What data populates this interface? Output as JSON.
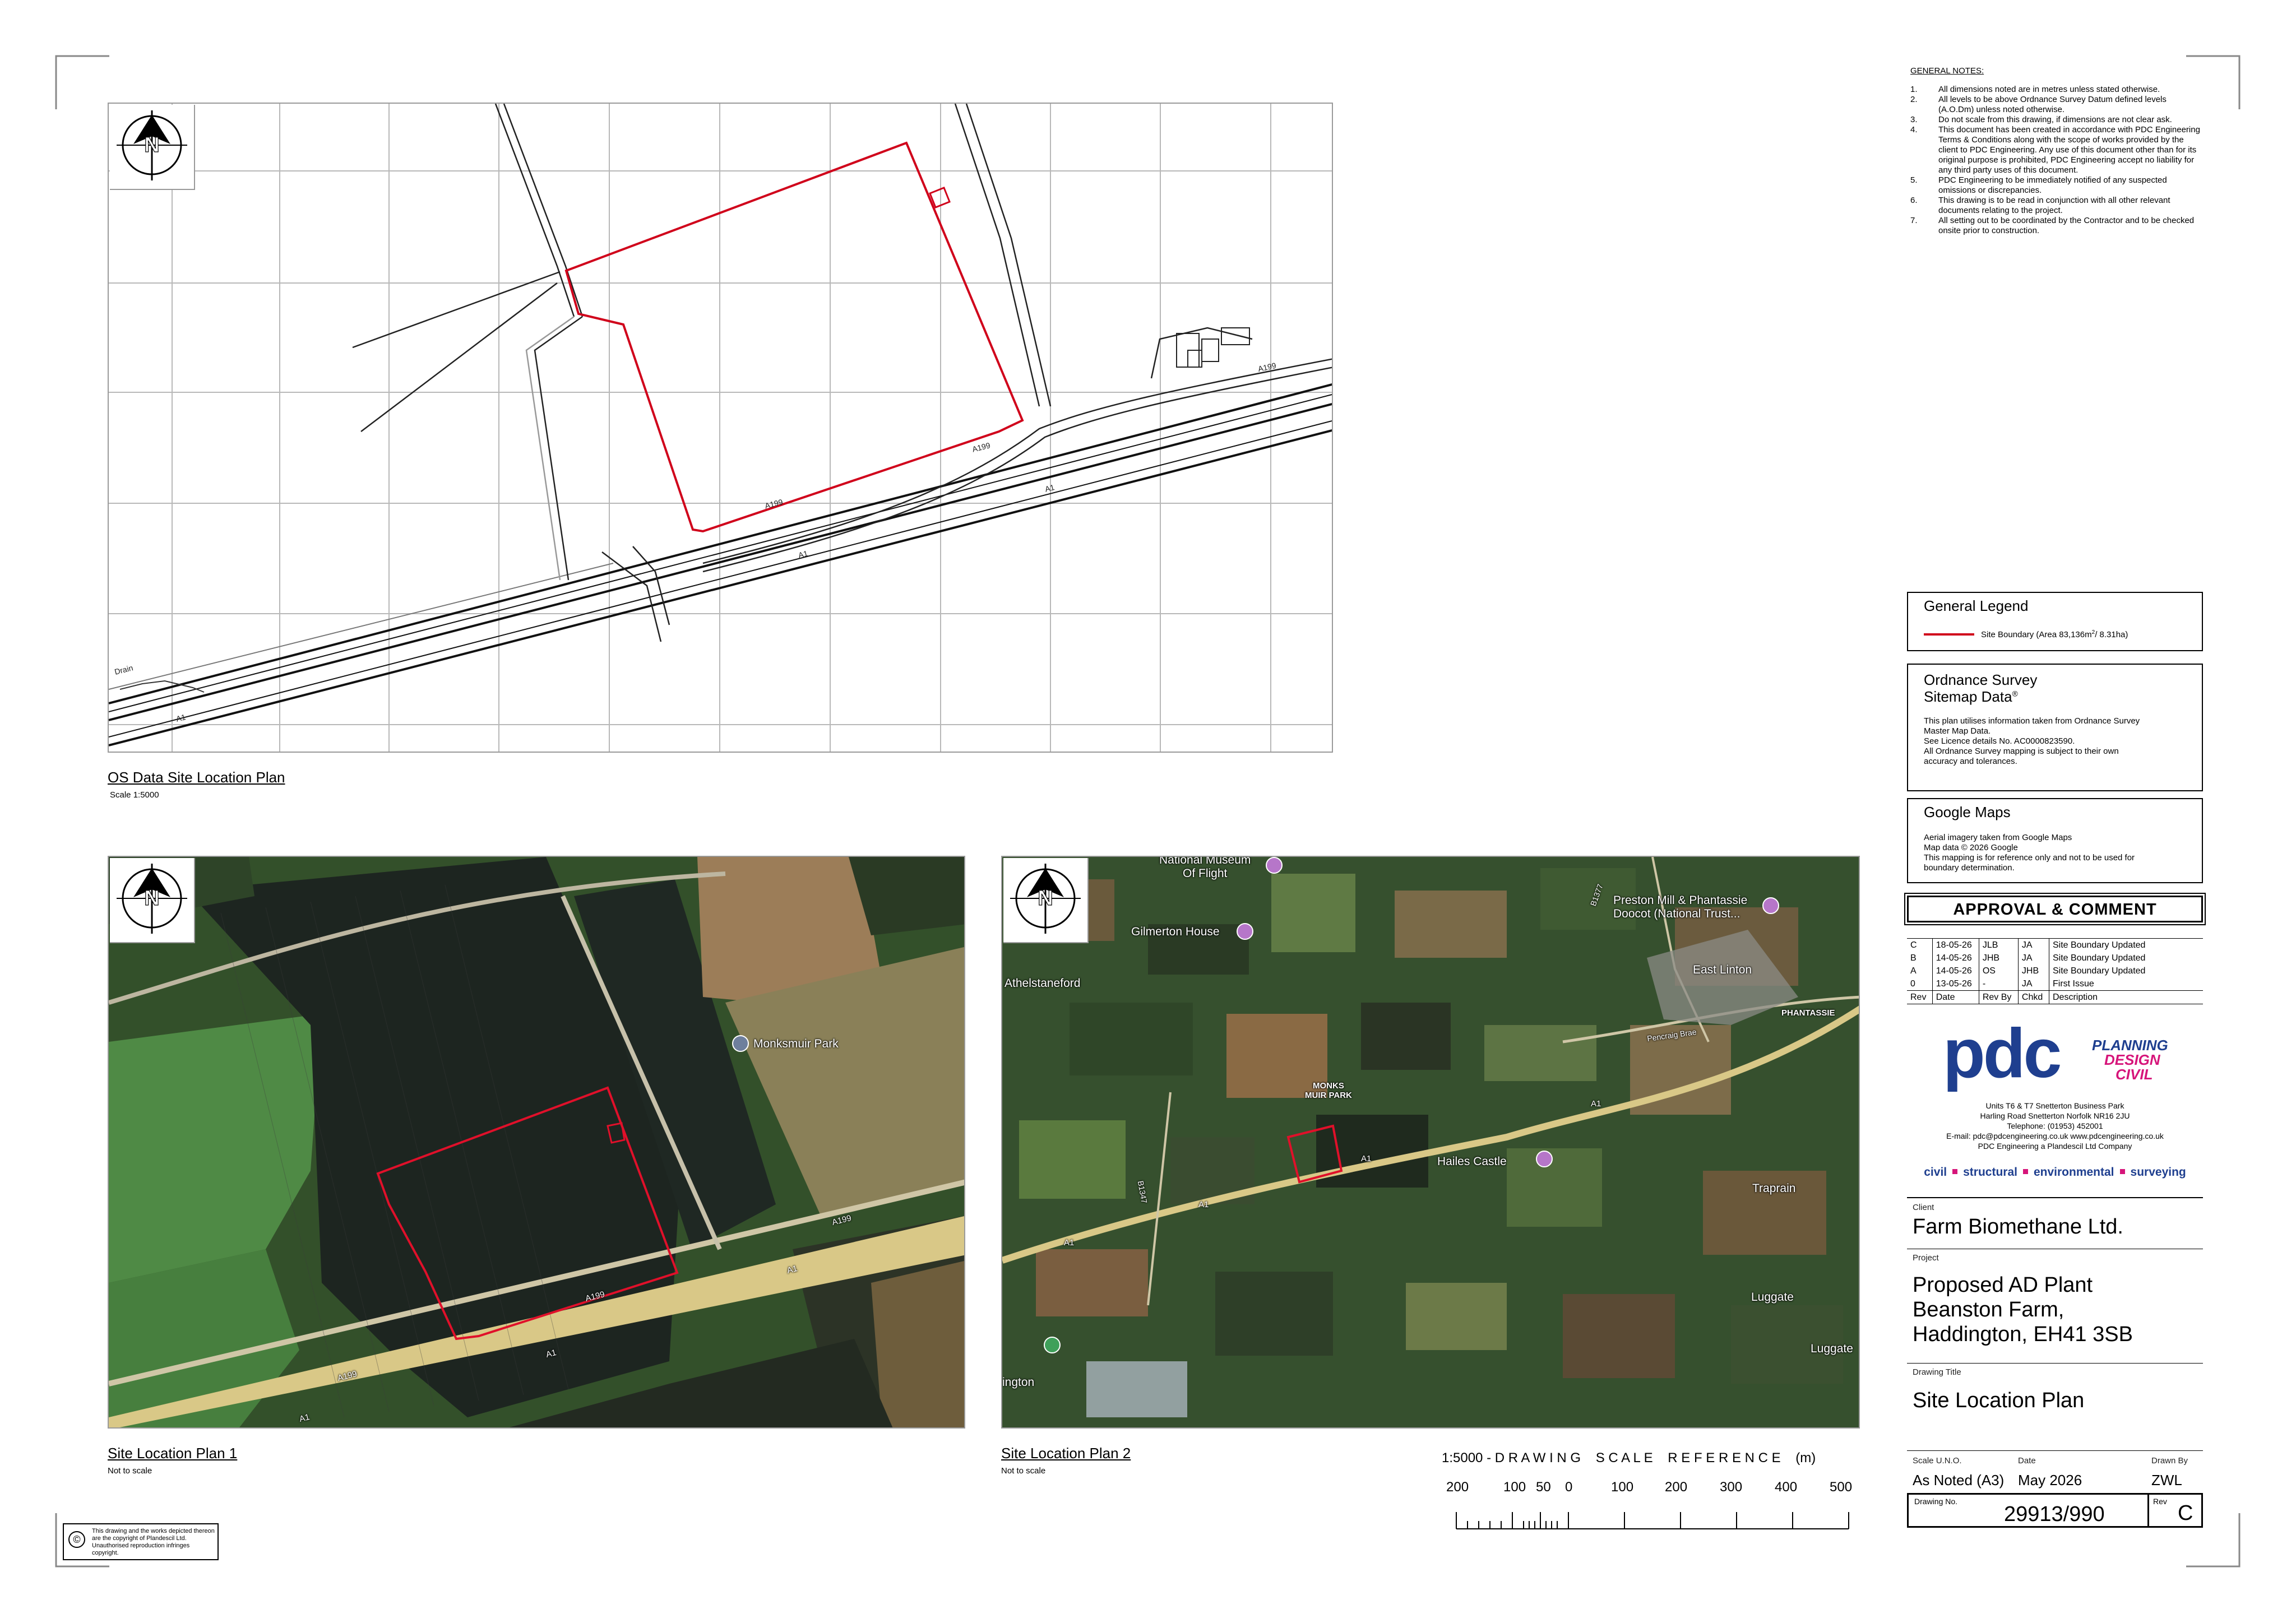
{
  "general_notes": {
    "heading": "GENERAL NOTES:",
    "items": [
      {
        "n": "1.",
        "text": "All dimensions noted are in metres unless stated otherwise."
      },
      {
        "n": "2.",
        "text": "All levels to be above Ordnance Survey Datum defined levels (A.O.Dm) unless noted otherwise."
      },
      {
        "n": "3.",
        "text": "Do not scale from this drawing, if dimensions are not clear ask."
      },
      {
        "n": "4.",
        "text": "This document has been created in accordance with PDC Engineering Terms & Conditions along with the scope of works provided by the client to PDC Engineering. Any use of this document other than for its original purpose is prohibited, PDC Engineering accept no liability for any third party uses of this document."
      },
      {
        "n": "5.",
        "text": "PDC Engineering to be immediately notified of any suspected omissions or discrepancies."
      },
      {
        "n": "6.",
        "text": "This drawing is to be read in conjunction with all other relevant documents relating to the project."
      },
      {
        "n": "7.",
        "text": "All setting out to be coordinated by the Contractor and to be checked onsite prior to construction."
      }
    ]
  },
  "legend": {
    "title": "General Legend",
    "item_label": "Site Boundary (Area 83,136m",
    "item_sup": "2",
    "item_tail": "/ 8.31ha)",
    "line_color": "#d0021b"
  },
  "os_box": {
    "title_line1": "Ordnance Survey",
    "title_line2": "Sitemap Data",
    "title_mark": "®",
    "lines": [
      "This plan utilises information taken from Ordnance Survey",
      "Master Map Data.",
      "See Licence details No. AC0000823590.",
      "All Ordnance Survey mapping is subject to their own",
      "accuracy and tolerances."
    ]
  },
  "google_box": {
    "title": "Google Maps",
    "lines": [
      "Aerial imagery taken from Google Maps",
      "Map data © 2026 Google",
      "This mapping is for reference only and not to be used for",
      "boundary determination."
    ]
  },
  "approval": {
    "title": "APPROVAL & COMMENT"
  },
  "revisions": {
    "rows": [
      {
        "rev": "C",
        "date": "18-05-26",
        "by": "JLB",
        "chkd": "JA",
        "desc": "Site Boundary Updated"
      },
      {
        "rev": "B",
        "date": "14-05-26",
        "by": "JHB",
        "chkd": "JA",
        "desc": "Site Boundary Updated"
      },
      {
        "rev": "A",
        "date": "14-05-26",
        "by": "OS",
        "chkd": "JHB",
        "desc": "Site Boundary Updated"
      },
      {
        "rev": "0",
        "date": "13-05-26",
        "by": "-",
        "chkd": "JA",
        "desc": "First Issue"
      }
    ],
    "header": {
      "rev": "Rev",
      "date": "Date",
      "by": "Rev By",
      "chkd": "Chkd",
      "desc": "Description"
    }
  },
  "company": {
    "logo_text": "pdc",
    "tag1": "PLANNING",
    "tag2": "DESIGN",
    "tag3": "CIVIL",
    "address_lines": [
      "Units T6 & T7   Snetterton Business Park",
      "Harling Road   Snetterton   Norfolk   NR16 2JU",
      "Telephone: (01953) 452001",
      "E-mail: pdc@pdcengineering.co.uk   www.pdcengineering.co.uk",
      "PDC Engineering a Plandescil Ltd Company"
    ],
    "services": [
      "civil",
      "structural",
      "environmental",
      "surveying"
    ],
    "brand_blue": "#1f3f8f",
    "brand_magenta": "#d6157a"
  },
  "title_block": {
    "client_label": "Client",
    "client": "Farm Biomethane Ltd.",
    "project_label": "Project",
    "project_lines": [
      "Proposed AD Plant",
      "Beanston Farm,",
      "Haddington, EH41 3SB"
    ],
    "drawing_title_label": "Drawing Title",
    "drawing_title": "Site Location Plan",
    "scale_label": "Scale   U.N.O.",
    "scale": "As Noted (A3)",
    "date_label": "Date",
    "date": "May 2026",
    "drawn_label": "Drawn By",
    "drawn": "ZWL",
    "drawing_no_label": "Drawing No.",
    "drawing_no": "29913/990",
    "rev_label": "Rev",
    "rev": "C"
  },
  "plans": {
    "os": {
      "title": "OS Data Site Location Plan",
      "sub": "Scale 1:5000"
    },
    "plan1": {
      "title": "Site Location Plan 1",
      "sub": "Not to scale"
    },
    "plan2": {
      "title": "Site Location Plan 2",
      "sub": "Not to scale"
    }
  },
  "scale_bar": {
    "title": "1:5000 - D R A W I N G    S C A L E    R E F E R E N C E    (m)",
    "ticks": [
      "200",
      "100",
      "50",
      "0",
      "100",
      "200",
      "300",
      "400",
      "500"
    ]
  },
  "copyright": {
    "symbol": "©",
    "text": "This drawing and the works depicted thereon are the copyright of Plandescil Ltd. Unauthorised reproduction infringes copyright."
  },
  "north_arrow": {
    "label": "N"
  },
  "os_map_labels": {
    "a199_top": "A199",
    "a199_mid": "A199",
    "a199_low": "A199",
    "a1_right": "A1",
    "a1_mid": "A1",
    "a1_left": "A1",
    "drain": "Drain"
  },
  "plan1_labels": {
    "poi": "Monksmuir Park",
    "a199_right": "A199",
    "a199_mid": "A199",
    "a199_left": "A199",
    "a1_right": "A1",
    "a1_mid": "A1",
    "a1_left": "A1"
  },
  "plan2_labels": {
    "museum": "National Museum\nOf Flight",
    "gilmerton": "Gilmerton House",
    "athel": "Athelstaneford",
    "preston": "Preston Mill & Phantassie\nDoocot (National Trust...",
    "eastlinton": "East Linton",
    "phantassie": "PHANTASSIE",
    "monks": "MONKS\nMUIR PARK",
    "hailes": "Hailes Castle",
    "traprain": "Traprain",
    "luggate": "Luggate",
    "luggate2": "Luggate",
    "ington": "ington",
    "b1377": "B1377",
    "b1347": "B1347",
    "a1a": "A1",
    "a1b": "A1",
    "a1c": "A1",
    "a1d": "A1",
    "pencraig": "Pencraig Brae"
  }
}
